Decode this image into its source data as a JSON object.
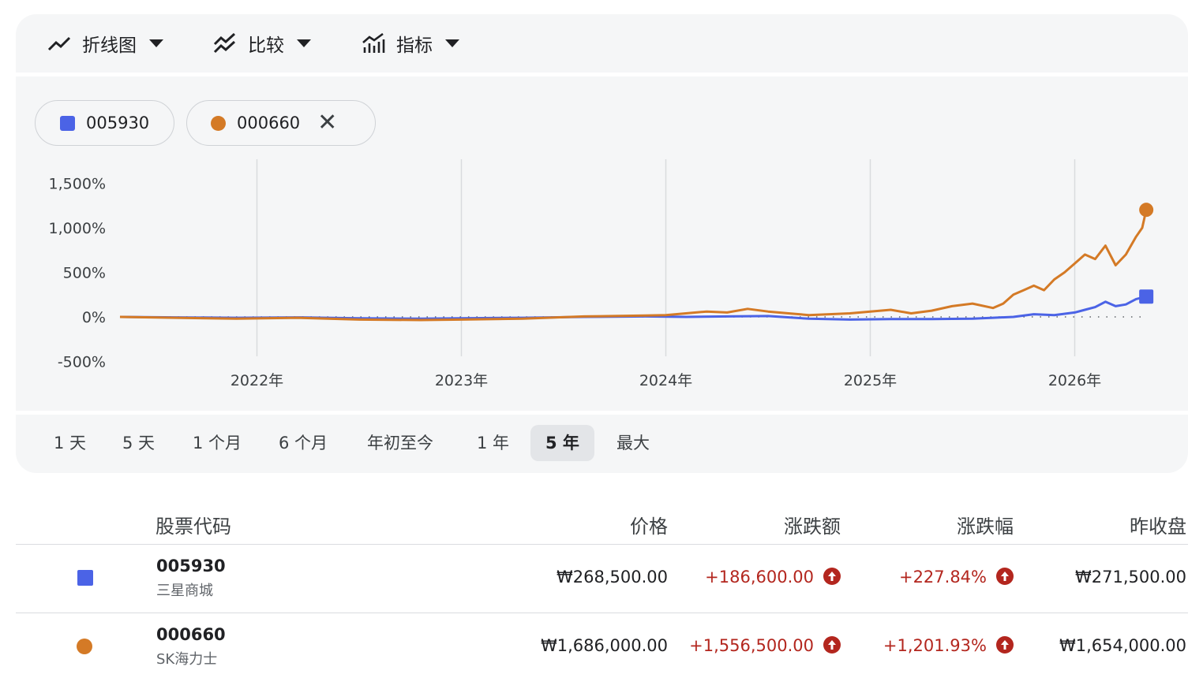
{
  "toolbar": {
    "chart_type": {
      "label": "折线图",
      "icon": "line-chart-icon"
    },
    "compare": {
      "label": "比较",
      "icon": "compare-icon"
    },
    "indicators": {
      "label": "指标",
      "icon": "indicators-icon"
    }
  },
  "chips": [
    {
      "ticker": "005930",
      "color": "#4b63e6",
      "shape": "square"
    },
    {
      "ticker": "000660",
      "color": "#d47a26",
      "shape": "circle",
      "removable": true
    }
  ],
  "ranges": [
    "1 天",
    "5 天",
    "1 个月",
    "6 个月",
    "年初至今",
    "1 年",
    "5 年",
    "最大"
  ],
  "active_range": "5 年",
  "table": {
    "headers": {
      "ticker": "股票代码",
      "price": "价格",
      "change": "涨跌额",
      "change_pct": "涨跌幅",
      "prev_close": "昨收盘"
    },
    "rows": [
      {
        "ticker": "005930",
        "name": "三星商城",
        "price": "₩268,500.00",
        "change": "+186,600.00",
        "change_pct": "+227.84%",
        "prev_close": "₩271,500.00",
        "color": "#4b63e6",
        "shape": "square"
      },
      {
        "ticker": "000660",
        "name": "SK海力士",
        "price": "₩1,686,000.00",
        "change": "+1,556,500.00",
        "change_pct": "+1,201.93%",
        "prev_close": "₩1,654,000.00",
        "color": "#d47a26",
        "shape": "circle"
      }
    ]
  },
  "chart_data": {
    "type": "line",
    "title": "",
    "xlabel": "",
    "ylabel": "",
    "y_unit": "%",
    "ylim": [
      -500,
      1500
    ],
    "y_ticks": [
      1500,
      1000,
      500,
      0,
      -500
    ],
    "y_tick_labels": [
      "1,500%",
      "1,000%",
      "500%",
      "0%",
      "-500%"
    ],
    "x_range": [
      2021.33,
      2026.35
    ],
    "x_ticks": [
      2022,
      2023,
      2024,
      2025,
      2026
    ],
    "x_tick_labels": [
      "2022年",
      "2023年",
      "2024年",
      "2025年",
      "2026年"
    ],
    "baseline": 0,
    "grid": "vertical",
    "series": [
      {
        "name": "005930",
        "color": "#4b63e6",
        "marker": "square",
        "x": [
          2021.33,
          2021.6,
          2021.9,
          2022.2,
          2022.5,
          2022.8,
          2023.0,
          2023.3,
          2023.6,
          2023.9,
          2024.1,
          2024.3,
          2024.5,
          2024.7,
          2024.9,
          2025.1,
          2025.3,
          2025.5,
          2025.6,
          2025.7,
          2025.8,
          2025.9,
          2026.0,
          2026.05,
          2026.1,
          2026.15,
          2026.2,
          2026.25,
          2026.3,
          2026.35
        ],
        "y": [
          0,
          -5,
          -10,
          -5,
          -15,
          -20,
          -15,
          -10,
          0,
          5,
          0,
          5,
          10,
          -20,
          -30,
          -25,
          -25,
          -20,
          -10,
          0,
          30,
          20,
          50,
          80,
          110,
          170,
          120,
          140,
          200,
          228
        ]
      },
      {
        "name": "000660",
        "color": "#d47a26",
        "marker": "circle",
        "x": [
          2021.33,
          2021.6,
          2021.9,
          2022.2,
          2022.5,
          2022.8,
          2023.0,
          2023.3,
          2023.6,
          2023.9,
          2024.0,
          2024.2,
          2024.3,
          2024.4,
          2024.5,
          2024.6,
          2024.7,
          2024.8,
          2024.9,
          2025.0,
          2025.1,
          2025.2,
          2025.3,
          2025.4,
          2025.5,
          2025.6,
          2025.65,
          2025.7,
          2025.75,
          2025.8,
          2025.85,
          2025.9,
          2025.95,
          2026.0,
          2026.05,
          2026.1,
          2026.15,
          2026.2,
          2026.25,
          2026.3,
          2026.33,
          2026.35
        ],
        "y": [
          0,
          -10,
          -20,
          -10,
          -30,
          -35,
          -30,
          -20,
          5,
          15,
          20,
          60,
          50,
          90,
          60,
          40,
          20,
          30,
          40,
          60,
          80,
          40,
          70,
          120,
          150,
          100,
          150,
          250,
          300,
          350,
          300,
          420,
          500,
          600,
          700,
          650,
          800,
          580,
          700,
          900,
          1000,
          1201.93
        ]
      }
    ]
  }
}
